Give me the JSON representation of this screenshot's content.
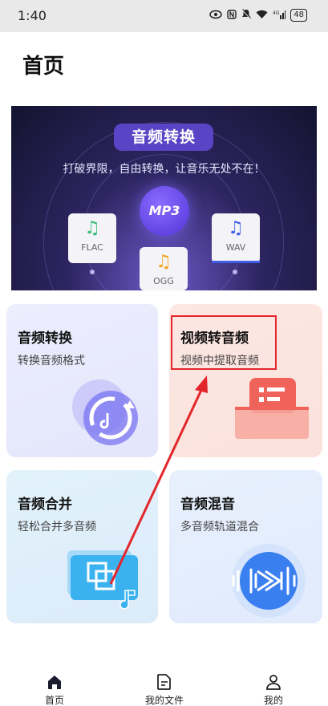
{
  "status": {
    "time": "1:40",
    "battery": "48",
    "signal": "4G"
  },
  "page": {
    "title": "首页"
  },
  "banner": {
    "title": "音频转换",
    "subtitle": "打破界限，自由转换，让音乐无处不在！",
    "center_format": "MP3",
    "formats": [
      {
        "label": "FLAC",
        "color": "#3bbf7a"
      },
      {
        "label": "OGG",
        "color": "#f2a623"
      },
      {
        "label": "WAV",
        "color": "#3f5ee8"
      }
    ]
  },
  "cards": [
    {
      "title": "音频转换",
      "subtitle": "转换音频格式",
      "accent": "#7a74f0"
    },
    {
      "title": "视频转音频",
      "subtitle": "视频中提取音频",
      "accent": "#f0635a"
    },
    {
      "title": "音频合并",
      "subtitle": "轻松合并多音频",
      "accent": "#3ab2f0"
    },
    {
      "title": "音频混音",
      "subtitle": "多音频轨道混合",
      "accent": "#3a7ff0"
    }
  ],
  "annotation": {
    "color": "#e3262b"
  },
  "nav": [
    {
      "label": "首页",
      "icon": "home-icon"
    },
    {
      "label": "我的文件",
      "icon": "document-icon"
    },
    {
      "label": "我的",
      "icon": "user-icon"
    }
  ]
}
